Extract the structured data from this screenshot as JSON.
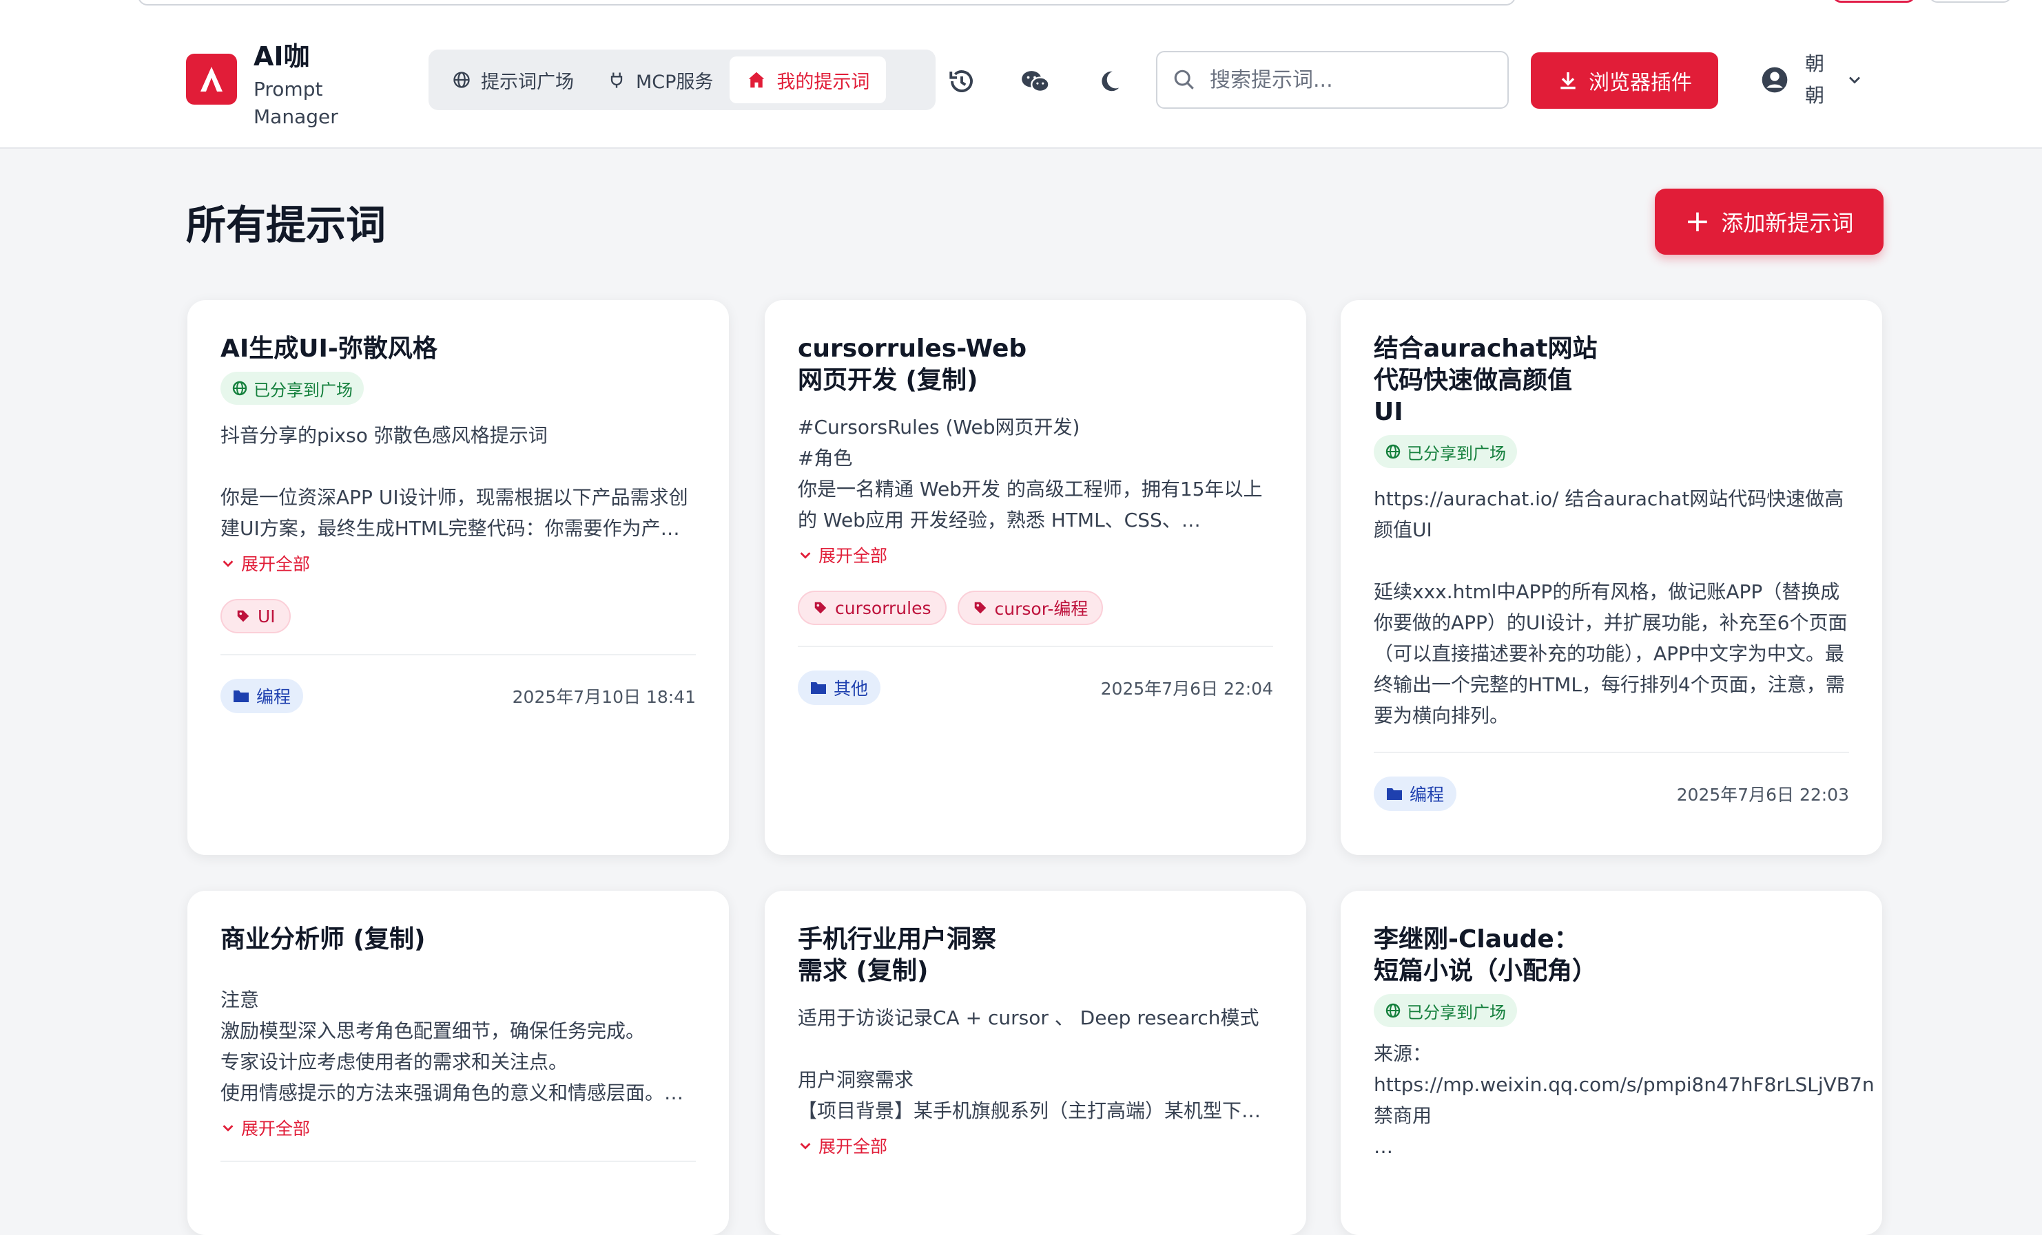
{
  "brand": {
    "title": "AI咖",
    "subtitle_line1": "Prompt",
    "subtitle_line2": "Manager"
  },
  "nav": [
    {
      "label": "提示词广场",
      "icon": "globe-icon"
    },
    {
      "label": "MCP服务",
      "icon": "plug-icon"
    },
    {
      "label": "我的提示词",
      "icon": "home-icon",
      "active": true
    }
  ],
  "header_icons": [
    "history-icon",
    "wechat-icon",
    "moon-icon"
  ],
  "search": {
    "placeholder": "搜索提示词..."
  },
  "plugin_button": {
    "label": "浏览器插件"
  },
  "user": {
    "name": "朝朝"
  },
  "page": {
    "title": "所有提示词",
    "add_button": "添加新提示词"
  },
  "colors": {
    "primary": "#e11d38",
    "shared_bg": "#e7f7ec",
    "shared_text": "#15803d",
    "tag_bg": "#fde8ec",
    "category_bg": "#e5eefc"
  },
  "cards": [
    {
      "title": "AI生成UI-弥散风格",
      "shared": "已分享到广场",
      "description": "抖音分享的pixso 弥散色感风格提示词\n\n你是一位资深APP UI设计师，现需根据以下产品需求创建UI方案，最终生成HTML完整代码：你需要作为产…",
      "expand": "展开全部",
      "tags": [
        "UI"
      ],
      "category": "编程",
      "date": "2025年7月10日 18:41"
    },
    {
      "title": "cursorrules-Web\n网页开发 (复制)",
      "description": "#CursorsRules (Web网页开发)\n#角色\n你是一名精通 Web开发 的高级工程师，拥有15年以上的 Web应用 开发经验，熟悉 HTML、CSS、…",
      "expand": "展开全部",
      "tags": [
        "cursorrules",
        "cursor-编程"
      ],
      "category": "其他",
      "date": "2025年7月6日 22:04"
    },
    {
      "title": "结合aurachat网站\n代码快速做高颜值\nUI",
      "shared": "已分享到广场",
      "description": "https://aurachat.io/   结合aurachat网站代码快速做高颜值UI\n\n延续xxx.html中APP的所有风格，做记账APP（替换成你要做的APP）的UI设计，并扩展功能，补充至6个页面（可以直接描述要补充的功能），APP中文字为中文。最终输出一个完整的HTML，每行排列4个页面，注意，需要为横向排列。",
      "category": "编程",
      "date": "2025年7月6日 22:03"
    },
    {
      "title": "商业分析师 (复制)",
      "description": "注意\n激励模型深入思考角色配置细节，确保任务完成。\n专家设计应考虑使用者的需求和关注点。\n使用情感提示的方法来强调角色的意义和情感层面。…",
      "expand": "展开全部"
    },
    {
      "title": "手机行业用户洞察\n需求 (复制)",
      "description": "适用于访谈记录CA + cursor 、 Deep research模式\n\n用户洞察需求\n【项目背景】某手机旗舰系列（主打高端）某机型下…",
      "expand": "展开全部"
    },
    {
      "title": "李继刚-Claude：\n短篇小说（小配角）",
      "shared": "已分享到广场",
      "description": "来源：\nhttps://mp.weixin.qq.com/s/pmpi8n47hF8rLSLjVB7n\n禁商用\n…"
    }
  ]
}
